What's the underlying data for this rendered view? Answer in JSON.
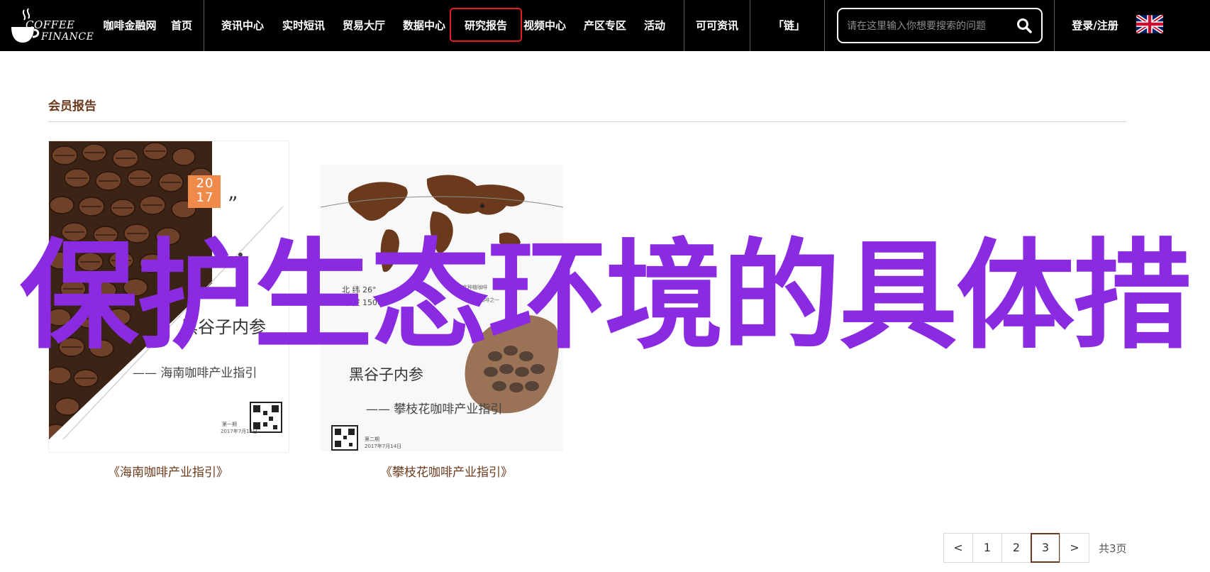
{
  "brand": {
    "line1": "COFFEE",
    "line2": "FINANCE"
  },
  "nav": {
    "items": [
      "咖啡金融网",
      "首页",
      "资讯中心",
      "实时短讯",
      "贸易大厅",
      "数据中心",
      "研究报告",
      "视频中心",
      "产区专区",
      "活动",
      "可可资讯",
      "「链」"
    ],
    "active": "研究报告",
    "login": "登录/注册"
  },
  "search": {
    "placeholder": "请在这里输入你想要搜索的问题"
  },
  "section": {
    "title": "会员报告"
  },
  "reports": [
    {
      "caption": "《海南咖啡产业指引》",
      "year": "2017",
      "heading": "黑谷子内参",
      "subtitle": "—— 海南咖啡产业指引",
      "issue": "第一期",
      "date": "2017年7月14日"
    },
    {
      "caption": "《攀枝花咖啡产业指引》",
      "lat_label": "北 纬 26°",
      "alt_label": "海 拔 1500",
      "note_right1": "最适宜种植咖啡",
      "note_right2": "精品咖啡之一",
      "heading": "黑谷子内参",
      "subtitle": "—— 攀枝花咖啡产业指引",
      "issue": "第二期",
      "date": "2017年7月14日"
    }
  ],
  "overlay": {
    "text": "保护生态环境的具体措"
  },
  "pagination": {
    "prev": "<",
    "pages": [
      "1",
      "2",
      "3"
    ],
    "current": "3",
    "next": ">",
    "total": "共3页"
  },
  "colors": {
    "active_border": "#e0201c",
    "accent_brown": "#6b3a1c",
    "overlay": "#8a2be2",
    "nav_bg": "#000000"
  }
}
